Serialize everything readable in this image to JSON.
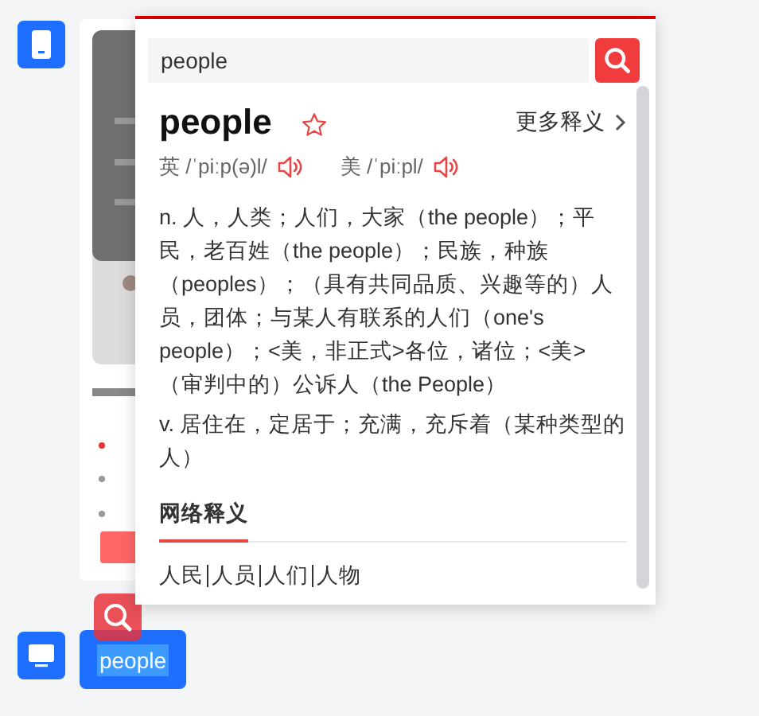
{
  "message": {
    "text": "people"
  },
  "popup": {
    "search": {
      "value": "people"
    },
    "word": "people",
    "favorite": false,
    "more_label": "更多释义",
    "phonetics": [
      {
        "region": "英",
        "ipa": "/ˈpiːp(ə)l/"
      },
      {
        "region": "美",
        "ipa": "/ˈpiːpl/"
      }
    ],
    "definitions": [
      "n. 人，人类；人们，大家（the people）；平民，老百姓（the people）；民族，种族（peoples）；（具有共同品质、兴趣等的）人员，团体；与某人有联系的人们（one's people）；<美，非正式>各位，诸位；<美>（审判中的）公诉人（the People）",
      "v. 居住在，定居于；充满，充斥着（某种类型的人）"
    ],
    "tabs": [
      {
        "label": "网络释义",
        "selected": true
      }
    ],
    "web_meanings": [
      "人民",
      "人员",
      "人们",
      "人物"
    ]
  }
}
